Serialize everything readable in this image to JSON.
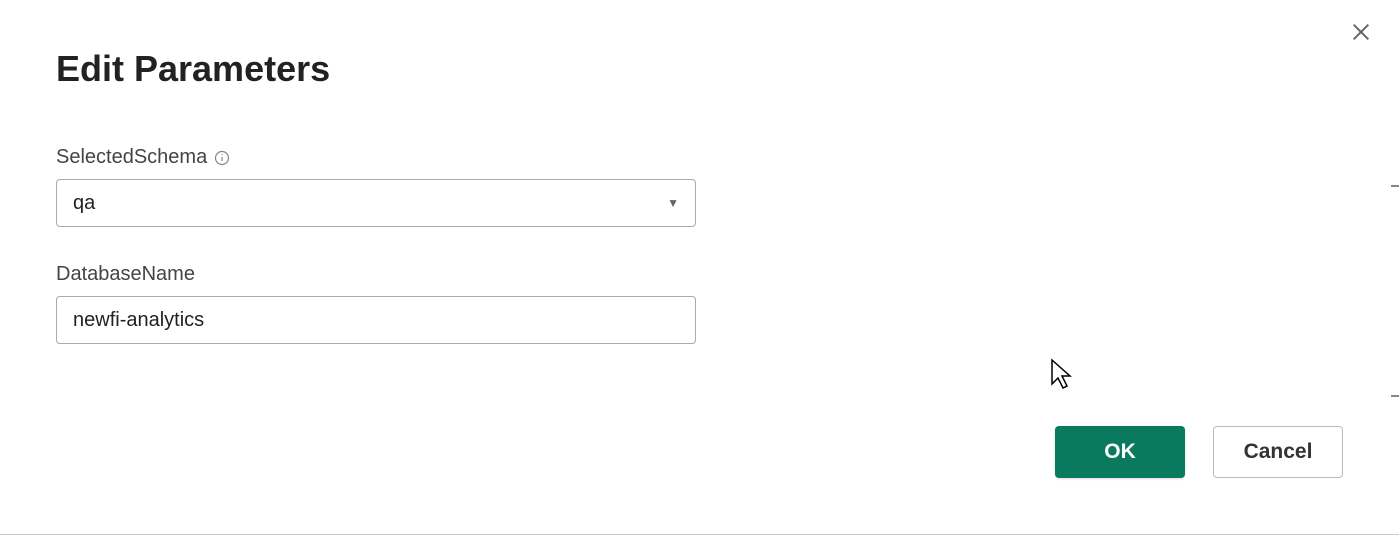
{
  "dialog": {
    "title": "Edit Parameters"
  },
  "fields": {
    "selectedSchema": {
      "label": "SelectedSchema",
      "value": "qa"
    },
    "databaseName": {
      "label": "DatabaseName",
      "value": "newfi-analytics"
    }
  },
  "buttons": {
    "ok": "OK",
    "cancel": "Cancel"
  }
}
